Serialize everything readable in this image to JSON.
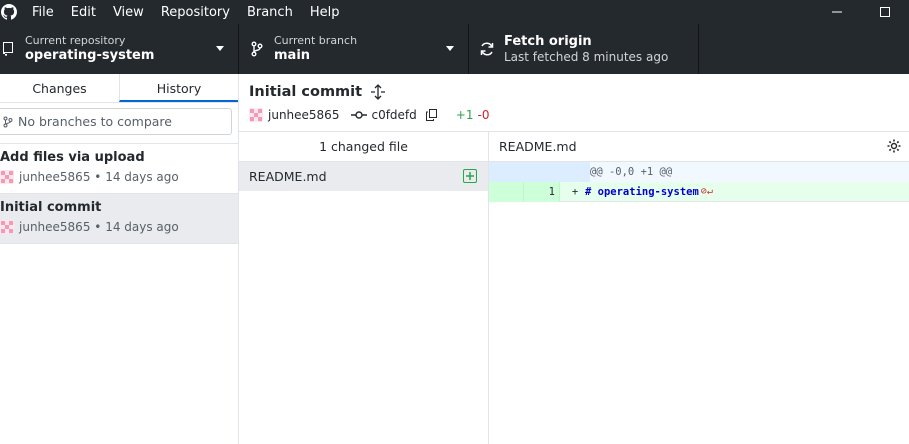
{
  "menu": {
    "items": [
      "File",
      "Edit",
      "View",
      "Repository",
      "Branch",
      "Help"
    ]
  },
  "toolbar": {
    "repo_label": "Current repository",
    "repo_value": "operating-system",
    "branch_label": "Current branch",
    "branch_value": "main",
    "fetch_title": "Fetch origin",
    "fetch_subtitle": "Last fetched 8 minutes ago"
  },
  "sidebar": {
    "tabs": [
      {
        "label": "Changes",
        "active": false
      },
      {
        "label": "History",
        "active": true
      }
    ],
    "compare_placeholder": "No branches to compare",
    "commits": [
      {
        "title": "Add files via upload",
        "author": "junhee5865",
        "time": "14 days ago",
        "selected": false
      },
      {
        "title": "Initial commit",
        "author": "junhee5865",
        "time": "14 days ago",
        "selected": true
      }
    ]
  },
  "commit": {
    "title": "Initial commit",
    "author": "junhee5865",
    "sha": "c0fdefd",
    "additions": "+1",
    "deletions": "-0"
  },
  "files": {
    "header": "1 changed file",
    "items": [
      {
        "name": "README.md",
        "status": "added"
      }
    ]
  },
  "diff": {
    "file": "README.md",
    "hunk": "@@ -0,0 +1 @@",
    "lines": [
      {
        "new_no": "1",
        "sign": "+",
        "code": "# operating-system"
      }
    ]
  },
  "colors": {
    "titlebar": "#24292e",
    "accent": "#0366d6",
    "added": "#28a745",
    "deleted": "#cb2431"
  }
}
